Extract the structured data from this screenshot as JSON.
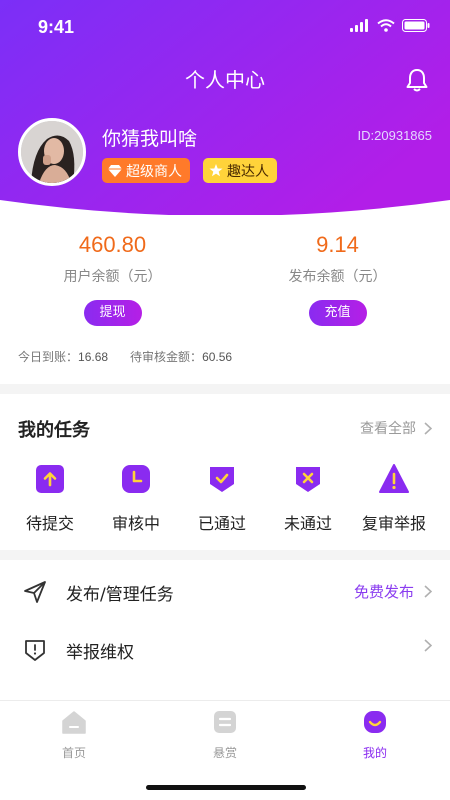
{
  "status_bar": {
    "time": "9:41"
  },
  "header": {
    "title": "个人中心"
  },
  "profile": {
    "name": "你猜我叫啥",
    "id_text": "ID:20931865",
    "badges": [
      {
        "label": "超级商人",
        "icon": "diamond-icon"
      },
      {
        "label": "趣达人",
        "icon": "star-icon"
      }
    ]
  },
  "balances": {
    "user": {
      "amount": "460.80",
      "label": "用户余额（元）",
      "button": "提现"
    },
    "publish": {
      "amount": "9.14",
      "label": "发布余额（元）",
      "button": "充值"
    },
    "today_label": "今日到账：",
    "today_value": "16.68",
    "pending_label": "待审核金额：",
    "pending_value": "60.56"
  },
  "tasks": {
    "title": "我的任务",
    "see_all": "查看全部",
    "items": [
      {
        "label": "待提交",
        "icon": "upload-icon"
      },
      {
        "label": "审核中",
        "icon": "clock-icon"
      },
      {
        "label": "已通过",
        "icon": "check-icon"
      },
      {
        "label": "未通过",
        "icon": "cross-icon"
      },
      {
        "label": "复审举报",
        "icon": "alert-icon"
      }
    ]
  },
  "menu": [
    {
      "label": "发布/管理任务",
      "right": "免费发布",
      "icon": "send-icon"
    },
    {
      "label": "举报维权",
      "right": "",
      "icon": "shield-alert-icon"
    }
  ],
  "tabbar": {
    "items": [
      {
        "label": "首页",
        "icon": "home-icon",
        "active": false
      },
      {
        "label": "悬赏",
        "icon": "reward-icon",
        "active": false
      },
      {
        "label": "我的",
        "icon": "profile-face-icon",
        "active": true
      }
    ]
  },
  "colors": {
    "accent": "#8a2bf0",
    "amount": "#f06a1a",
    "merchant_badge": "#ff7a2a",
    "expert_badge": "#ffd33a"
  }
}
